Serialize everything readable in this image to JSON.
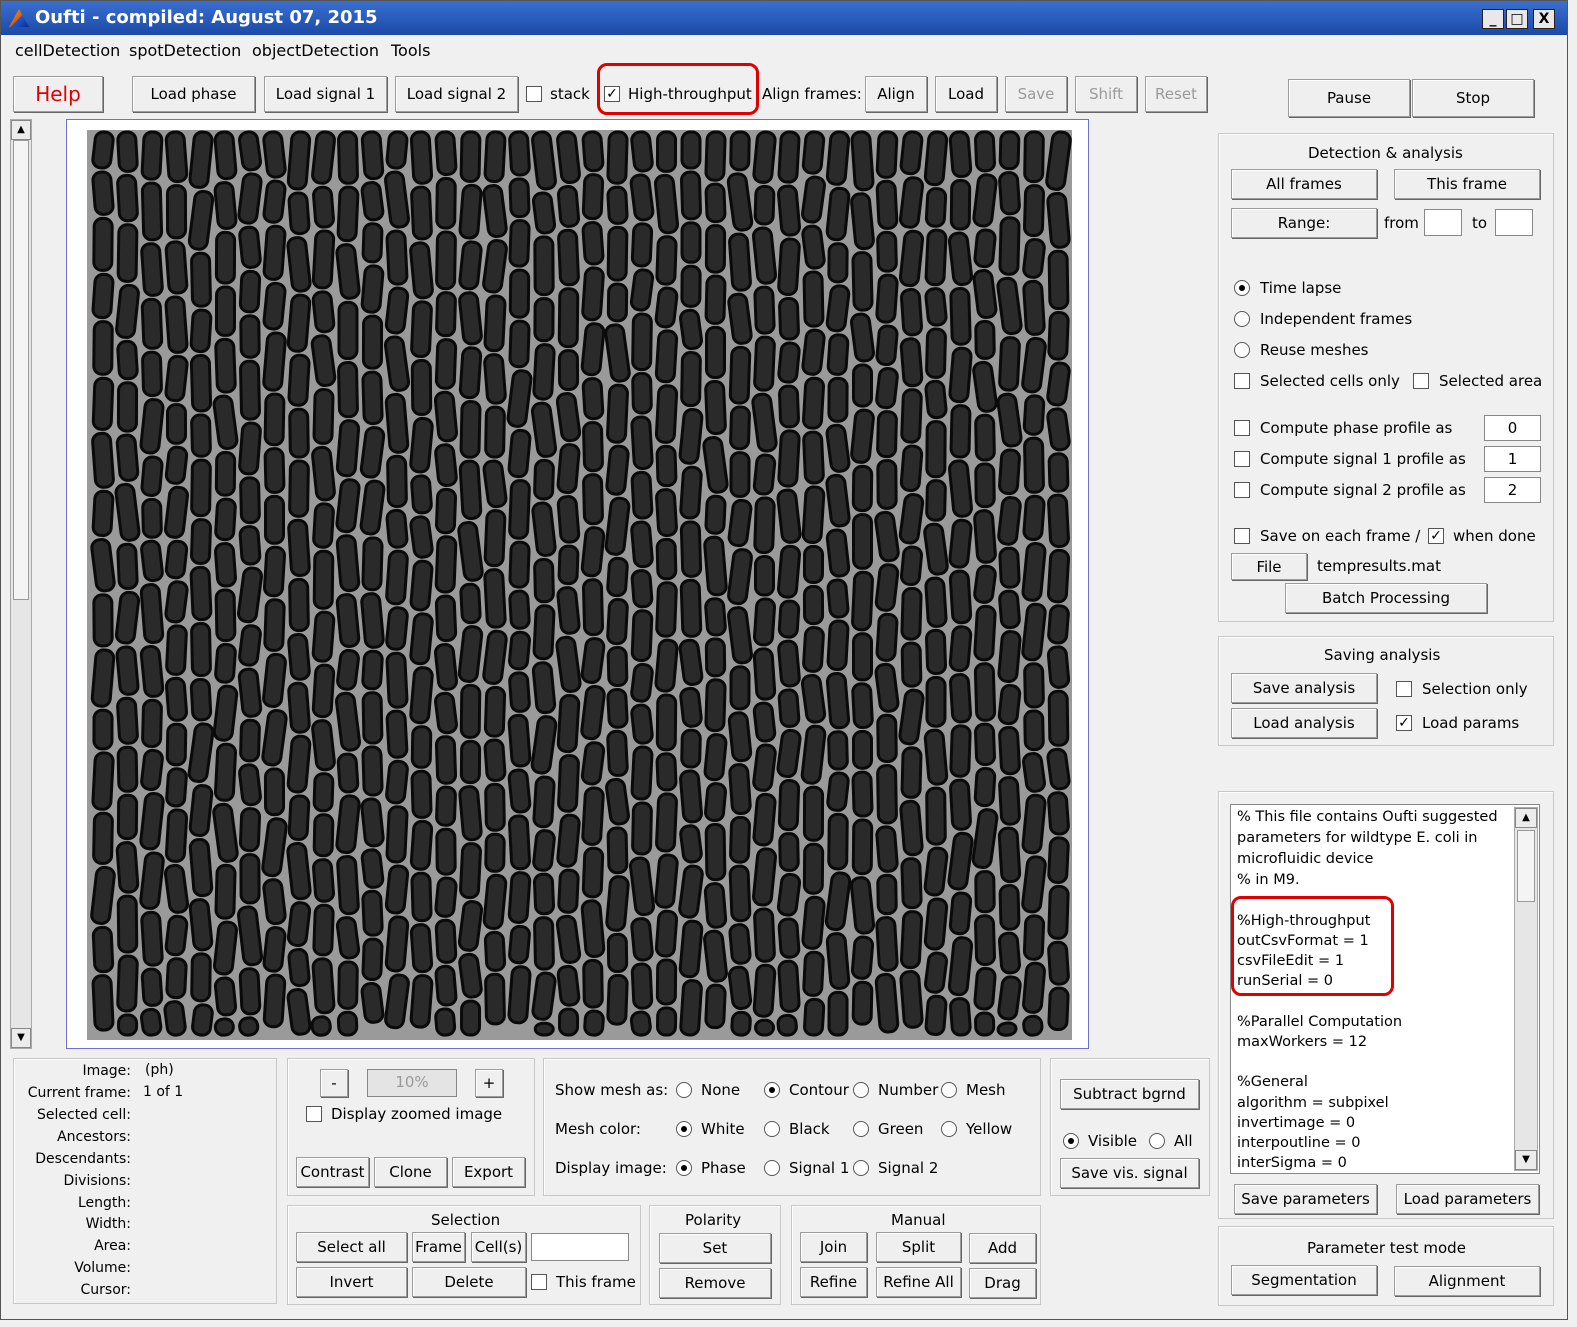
{
  "window": {
    "title": "Oufti - compiled: August 07, 2015",
    "icon": "matlab-icon",
    "min": "_",
    "max": "□",
    "close": "X"
  },
  "menu": [
    "cellDetection",
    "spotDetection",
    "objectDetection",
    "Tools"
  ],
  "toolbar": {
    "help": "Help",
    "load_phase": "Load phase",
    "load_signal1": "Load signal 1",
    "load_signal2": "Load signal 2",
    "stack": "stack",
    "high_throughput": "High-throughput",
    "align_frames": "Align frames:",
    "align": "Align",
    "load": "Load",
    "save": "Save",
    "shift": "Shift",
    "reset": "Reset",
    "pause": "Pause",
    "stop": "Stop"
  },
  "detection": {
    "title": "Detection & analysis",
    "all_frames": "All frames",
    "this_frame": "This frame",
    "range": "Range:",
    "from": "from",
    "to": "to",
    "time_lapse": "Time lapse",
    "independent": "Independent frames",
    "reuse": "Reuse meshes",
    "selected_cells": "Selected cells only",
    "selected_area": "Selected area",
    "phase_profile": "Compute phase profile as",
    "phase_val": "0",
    "sig1_profile": "Compute signal 1 profile as",
    "sig1_val": "1",
    "sig2_profile": "Compute signal 2 profile as",
    "sig2_val": "2",
    "save_each": "Save on each frame /",
    "when_done": "when done",
    "file": "File",
    "filename": "tempresults.mat",
    "batch": "Batch Processing"
  },
  "saving": {
    "title": "Saving analysis",
    "save_analysis": "Save analysis",
    "selection_only": "Selection only",
    "load_analysis": "Load analysis",
    "load_params": "Load params"
  },
  "params_text": {
    "l1": "% This file contains Oufti suggested",
    "l2": "parameters for wildtype E. coli in",
    "l3": "microfluidic device",
    "l4": "% in M9.",
    "l5": "%High-throughput",
    "l6": "outCsvFormat = 1",
    "l7": "csvFileEdit = 1",
    "l8": "runSerial = 0",
    "l9": "%Parallel Computation",
    "l10": "maxWorkers = 12",
    "l11": "%General",
    "l12": "algorithm = subpixel",
    "l13": "invertimage = 0",
    "l14": "interpoutline = 0",
    "l15": "interSigma = 0"
  },
  "params_buttons": {
    "save": "Save parameters",
    "load": "Load parameters"
  },
  "test_mode": {
    "title": "Parameter test mode",
    "segmentation": "Segmentation",
    "alignment": "Alignment"
  },
  "info": {
    "image_l": "Image:",
    "image_v": "(ph)",
    "frame_l": "Current frame:",
    "frame_v": "1 of 1",
    "selected_l": "Selected cell:",
    "ancestors": "Ancestors:",
    "descendants": "Descendants:",
    "divisions": "Divisions:",
    "length": "Length:",
    "width": "Width:",
    "area": "Area:",
    "volume": "Volume:",
    "cursor": "Cursor:"
  },
  "zoom": {
    "minus": "-",
    "value": "10%",
    "plus": "+",
    "display_zoomed": "Display zoomed image",
    "contrast": "Contrast",
    "clone": "Clone",
    "export": "Export"
  },
  "mesh": {
    "show_as": "Show mesh as:",
    "none": "None",
    "contour": "Contour",
    "number": "Number",
    "mesh": "Mesh",
    "color": "Mesh color:",
    "white": "White",
    "black": "Black",
    "green": "Green",
    "yellow": "Yellow",
    "display": "Display image:",
    "phase": "Phase",
    "signal1": "Signal 1",
    "signal2": "Signal 2"
  },
  "bgrnd": {
    "subtract": "Subtract bgrnd",
    "visible": "Visible",
    "all": "All",
    "save_vis": "Save vis. signal"
  },
  "selection": {
    "title": "Selection",
    "select_all": "Select all",
    "frame": "Frame",
    "cells": "Cell(s)",
    "invert": "Invert",
    "delete": "Delete",
    "this_frame": "This frame"
  },
  "polarity": {
    "title": "Polarity",
    "set": "Set",
    "remove": "Remove"
  },
  "manual": {
    "title": "Manual",
    "join": "Join",
    "split": "Split",
    "add": "Add",
    "refine": "Refine",
    "refine_all": "Refine All",
    "drag": "Drag"
  },
  "colors": {
    "highlight": "#e00000",
    "titlebar": "#1a4aa8"
  }
}
